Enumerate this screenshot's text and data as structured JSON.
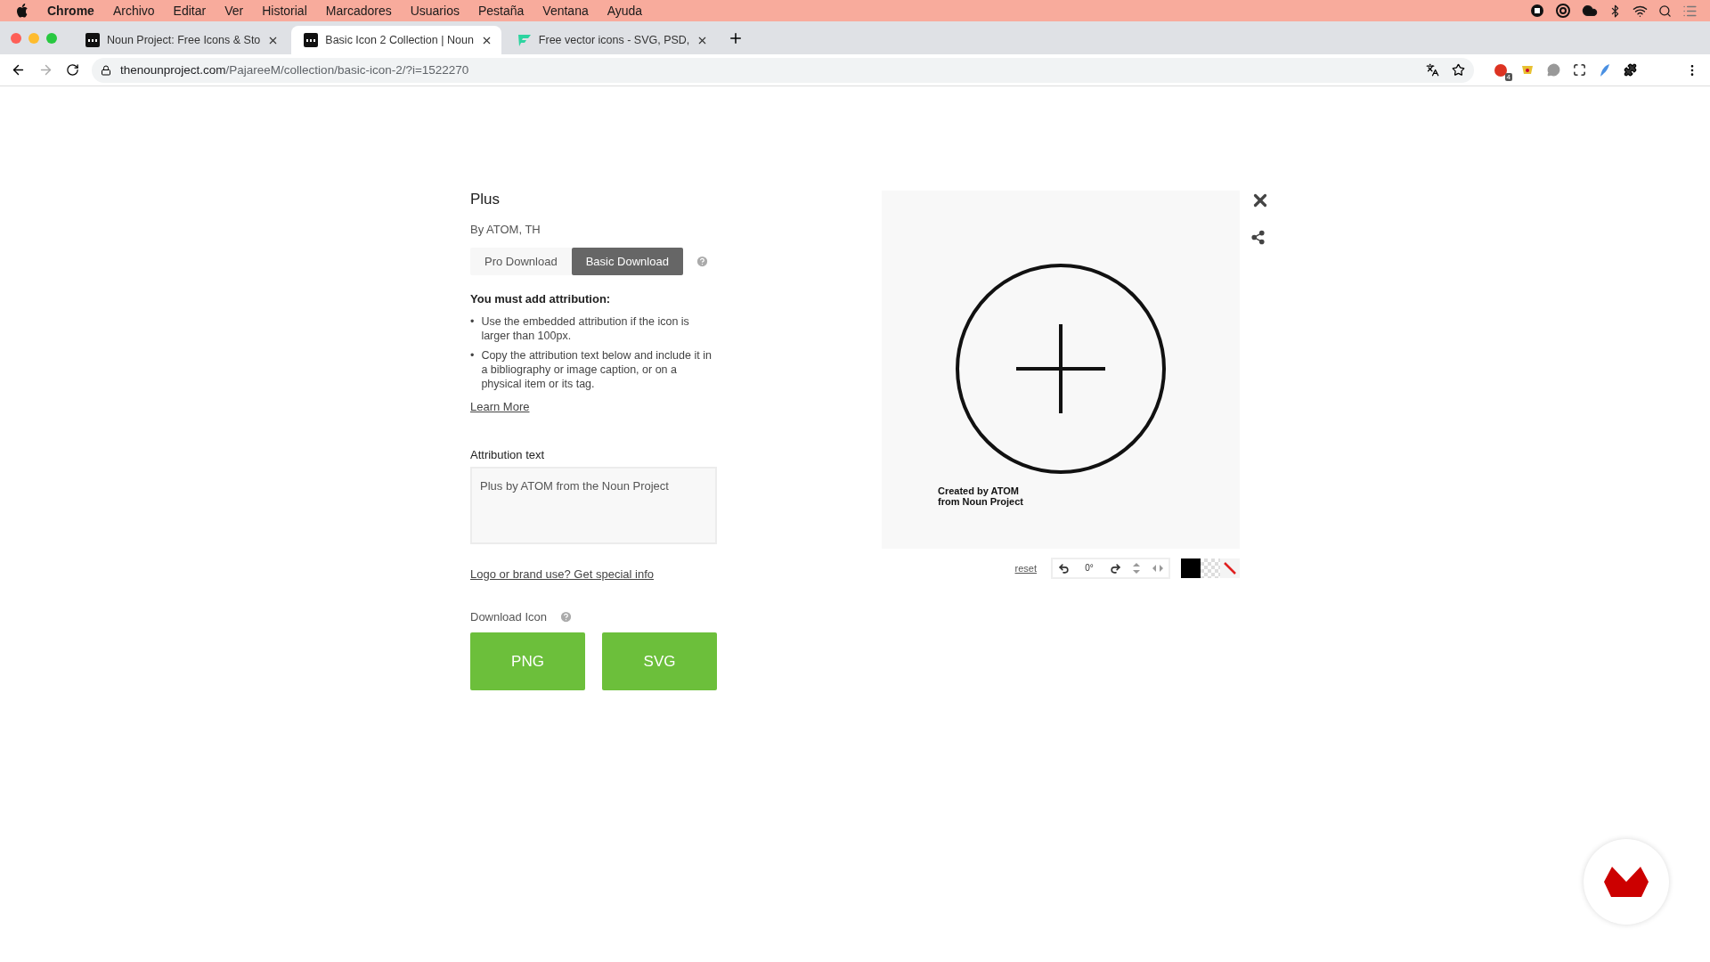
{
  "menu_bar": {
    "items": [
      {
        "label": "Chrome",
        "bold": true
      },
      {
        "label": "Archivo",
        "bold": false
      },
      {
        "label": "Editar",
        "bold": false
      },
      {
        "label": "Ver",
        "bold": false
      },
      {
        "label": "Historial",
        "bold": false
      },
      {
        "label": "Marcadores",
        "bold": false
      },
      {
        "label": "Usuarios",
        "bold": false
      },
      {
        "label": "Pestaña",
        "bold": false
      },
      {
        "label": "Ventana",
        "bold": false
      },
      {
        "label": "Ayuda",
        "bold": false
      }
    ]
  },
  "tabs": [
    {
      "title": "Noun Project: Free Icons & Sto",
      "selected": false,
      "kind": "noun"
    },
    {
      "title": "Basic Icon 2 Collection | Noun",
      "selected": true,
      "kind": "noun"
    },
    {
      "title": "Free vector icons - SVG, PSD,",
      "selected": false,
      "kind": "flaticon"
    }
  ],
  "address_bar": {
    "host": "thenounproject.com",
    "path": "/PajareeM/collection/basic-icon-2/?i=1522270",
    "extension_badge": "4"
  },
  "icon_details": {
    "title": "Plus",
    "author": "By ATOM, TH",
    "download_tabs": [
      {
        "label": "Pro Download",
        "selected": false
      },
      {
        "label": "Basic Download",
        "selected": true
      }
    ],
    "attribution_heading": "You must add attribution:",
    "bullets": [
      {
        "marker": "•",
        "text": "Use the embedded attribution if the icon is larger than 100px."
      },
      {
        "marker": "•",
        "text": "Copy the attribution text below and include it in a bibliography or image caption, or on a physical item or its tag."
      }
    ],
    "learn_more": "Learn More",
    "attribution_label": "Attribution text",
    "attribution_value": "Plus by ATOM from the Noun Project",
    "brand_link": "Logo or brand use? Get special info",
    "download_label": "Download Icon",
    "download_buttons": [
      "PNG",
      "SVG"
    ]
  },
  "preview": {
    "caption": [
      "Created by ATOM",
      "from Noun Project"
    ],
    "reset": "reset",
    "rotation": "0°",
    "swatches": [
      {
        "kind": "solid",
        "color": "#000000"
      },
      {
        "kind": "checker"
      },
      {
        "kind": "none"
      }
    ]
  }
}
